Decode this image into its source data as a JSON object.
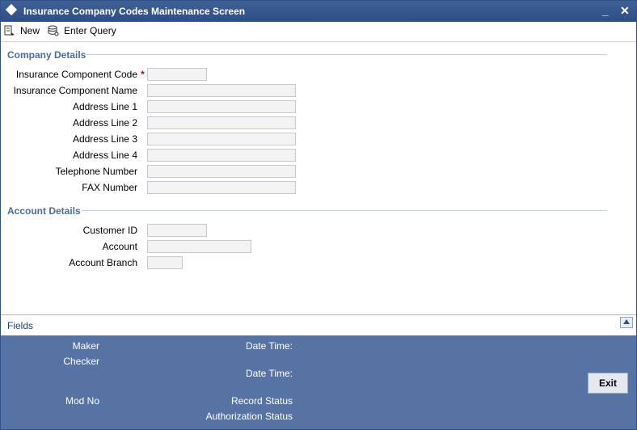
{
  "window": {
    "title": "Insurance Company Codes Maintenance Screen",
    "minimize": "_",
    "close": "✕"
  },
  "toolbar": {
    "new_label": "New",
    "enter_query_label": "Enter Query"
  },
  "company_details": {
    "title": "Company Details",
    "fields": {
      "component_code": "Insurance Component Code",
      "required_marker": "*",
      "component_name": "Insurance Component Name",
      "address1": "Address Line 1",
      "address2": "Address Line 2",
      "address3": "Address Line 3",
      "address4": "Address Line 4",
      "telephone": "Telephone Number",
      "fax": "FAX Number"
    }
  },
  "account_details": {
    "title": "Account Details",
    "fields": {
      "customer_id": "Customer ID",
      "account": "Account",
      "account_branch": "Account Branch"
    }
  },
  "footer": {
    "fields_link": "Fields"
  },
  "audit": {
    "maker": "Maker",
    "checker": "Checker",
    "date_time_1": "Date Time:",
    "date_time_2": "Date Time:",
    "mod_no": "Mod No",
    "record_status": "Record Status",
    "authorization_status": "Authorization Status",
    "exit_label": "Exit"
  },
  "colors": {
    "title_bar": "#2d4e86",
    "section_title": "#4a6b9d",
    "audit_panel": "#5773a4",
    "required": "#cc0000"
  },
  "icons": {
    "title": "diamond-icon",
    "new": "new-document-icon",
    "enter_query": "query-database-icon",
    "expand": "chevron-up-icon"
  }
}
